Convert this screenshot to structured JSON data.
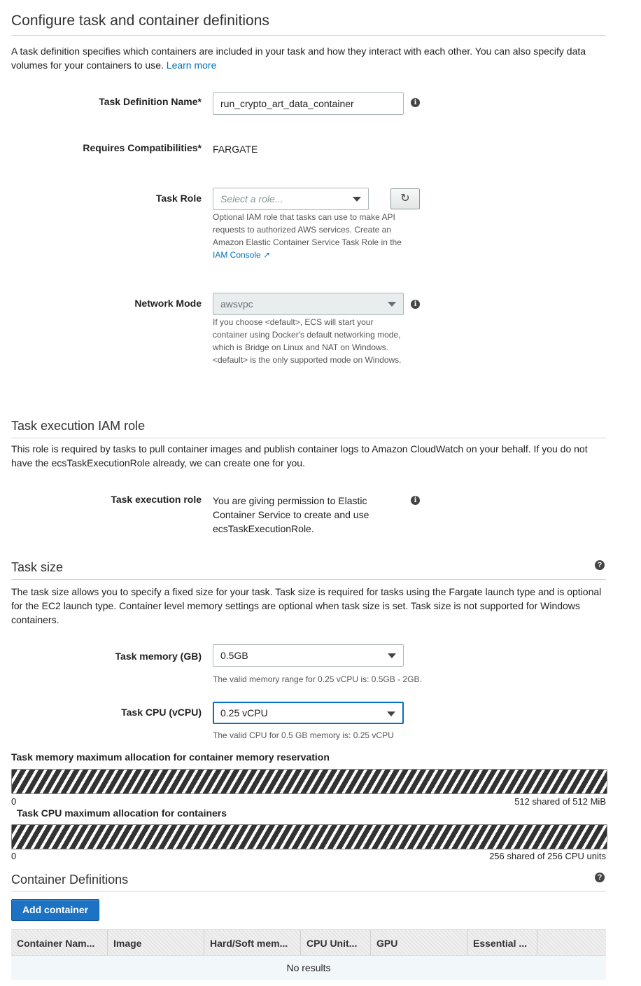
{
  "configure": {
    "title": "Configure task and container definitions",
    "description": "A task definition specifies which containers are included in your task and how they interact with each other. You can also specify data volumes for your containers to use.",
    "learn_more": "Learn more"
  },
  "task_definition_name": {
    "label": "Task Definition Name*",
    "value": "run_crypto_art_data_container"
  },
  "requires_compatibilities": {
    "label": "Requires Compatibilities*",
    "value": "FARGATE"
  },
  "task_role": {
    "label": "Task Role",
    "placeholder": "Select a role...",
    "help": "Optional IAM role that tasks can use to make API requests to authorized AWS services. Create an Amazon Elastic Container Service Task Role in the",
    "help_link": "IAM Console"
  },
  "network_mode": {
    "label": "Network Mode",
    "value": "awsvpc",
    "help": "If you choose <default>, ECS will start your container using Docker's default networking mode, which is Bridge on Linux and NAT on Windows. <default> is the only supported mode on Windows."
  },
  "execution": {
    "title": "Task execution IAM role",
    "description": "This role is required by tasks to pull container images and publish container logs to Amazon CloudWatch on your behalf. If you do not have the ecsTaskExecutionRole already, we can create one for you.",
    "role_label": "Task execution role",
    "role_text": "You are giving permission to Elastic Container Service to create and use ecsTaskExecutionRole."
  },
  "task_size": {
    "title": "Task size",
    "description": "The task size allows you to specify a fixed size for your task. Task size is required for tasks using the Fargate launch type and is optional for the EC2 launch type. Container level memory settings are optional when task size is set. Task size is not supported for Windows containers.",
    "memory_label": "Task memory (GB)",
    "memory_value": "0.5GB",
    "memory_help": "The valid memory range for 0.25 vCPU is: 0.5GB - 2GB.",
    "cpu_label": "Task CPU (vCPU)",
    "cpu_value": "0.25 vCPU",
    "cpu_help": "The valid CPU for 0.5 GB memory is: 0.25 vCPU"
  },
  "memory_allocation": {
    "title": "Task memory maximum allocation for container memory reservation",
    "min": "0",
    "max_text": "512 shared of 512 MiB",
    "fill_fraction": 1.0
  },
  "cpu_allocation": {
    "title": "Task CPU maximum allocation for containers",
    "min": "0",
    "max_text": "256 shared of 256 CPU units",
    "fill_fraction": 1.0
  },
  "containers": {
    "title": "Container Definitions",
    "add_button": "Add container",
    "columns": [
      "Container Nam...",
      "Image",
      "Hard/Soft mem...",
      "CPU Unit...",
      "GPU",
      "Essential ..."
    ],
    "empty": "No results"
  },
  "colors": {
    "link": "#0073bb",
    "primary_button": "#1c73c4",
    "focus_border": "#0073bb"
  }
}
